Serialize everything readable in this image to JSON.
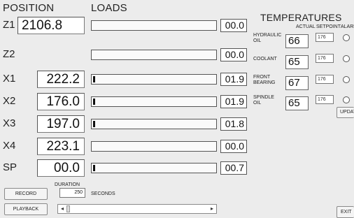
{
  "headers": {
    "position": "POSITION",
    "loads": "LOADS",
    "temperatures": "TEMPERATURES"
  },
  "axes": [
    {
      "label": "Z1",
      "position": "2106.8",
      "load": "00.0",
      "load_fraction": 0.0,
      "show_bar": true
    },
    {
      "label": "Z2",
      "position": "",
      "load": "00.0",
      "load_fraction": 0.0,
      "show_bar": true
    },
    {
      "label": "X1",
      "position": "222.2",
      "load": "01.9",
      "load_fraction": 0.019
    },
    {
      "label": "X2",
      "position": "176.0",
      "load": "01.9",
      "load_fraction": 0.019
    },
    {
      "label": "X3",
      "position": "197.0",
      "load": "01.8",
      "load_fraction": 0.018
    },
    {
      "label": "X4",
      "position": "223.1",
      "load": "00.0",
      "load_fraction": 0.0
    },
    {
      "label": "SP",
      "position": "00.0",
      "load": "00.7",
      "load_fraction": 0.01
    }
  ],
  "temperature_columns": {
    "actual": "ACTUAL",
    "setpoint": "SETPOINT",
    "alarm": "ALARM"
  },
  "temperatures": [
    {
      "label_line1": "HYDRAULIC",
      "label_line2": "OIL",
      "actual": "66",
      "setpoint": "176"
    },
    {
      "label_line1": "COOLANT",
      "label_line2": "",
      "actual": "65",
      "setpoint": "176"
    },
    {
      "label_line1": "FRONT",
      "label_line2": "BEARING",
      "actual": "67",
      "setpoint": "176"
    },
    {
      "label_line1": "SPINDLE",
      "label_line2": "OIL",
      "actual": "65",
      "setpoint": "176"
    }
  ],
  "update_button": "UPDATE",
  "record": {
    "button": "RECORD",
    "duration_label": "DURATION",
    "duration_value": "250",
    "seconds_label": "SECONDS"
  },
  "playback": {
    "button": "PLAYBACK",
    "left_arrow": "◂",
    "right_arrow": "▸"
  },
  "exit_button": "EXIT"
}
